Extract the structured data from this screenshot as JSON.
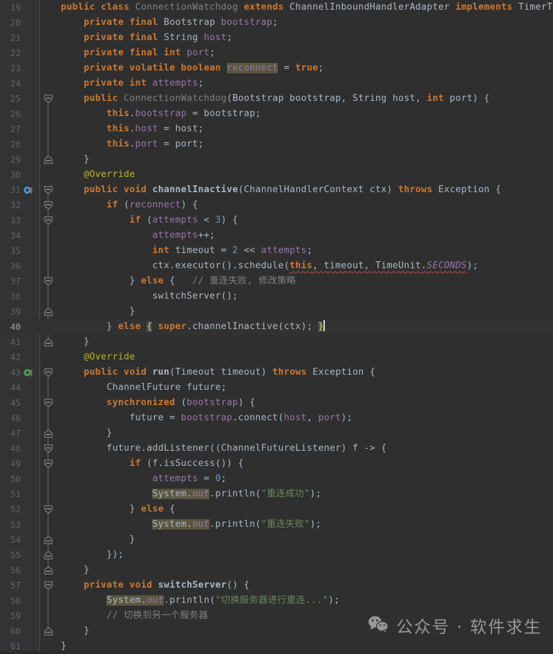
{
  "editor": {
    "language": "Java",
    "theme": "Darcula",
    "background": "#2f2f2f",
    "gutter_background": "#313335",
    "current_line": 40,
    "first_line": 19,
    "last_line": 61,
    "colors": {
      "keyword": "#cc7832",
      "string": "#6a8759",
      "number": "#6897bb",
      "comment": "#808080",
      "annotation": "#bbb529",
      "field": "#9876aa",
      "method": "#ffc66d",
      "default_text": "#a9b7c6",
      "line_number": "#606366",
      "identifier_highlight": "#5b5640",
      "brace_match": "#3b514d",
      "error_squiggle": "#9e4444"
    }
  },
  "lines": [
    {
      "n": 19,
      "indent": 0,
      "html": "<span class=\"kw-b\">public</span> <span class=\"kw-b\">class</span> <span class=\"dim\">ConnectionWatchdog</span> <span class=\"kw-b\">extends</span> <span class=\"typ\">ChannelInboundHandlerAdapter</span> <span class=\"kw-b\">implements</span> <span class=\"typ\">TimerTask</span> {"
    },
    {
      "n": 20,
      "indent": 1,
      "html": "    <span class=\"kw-b\">private</span> <span class=\"kw-b\">final</span> <span class=\"typ\">Bootstrap</span> <span class=\"fld\">bootstrap</span>;"
    },
    {
      "n": 21,
      "indent": 1,
      "html": "    <span class=\"kw-b\">private</span> <span class=\"kw-b\">final</span> <span class=\"typ\">String</span> <span class=\"fld\">host</span>;"
    },
    {
      "n": 22,
      "indent": 1,
      "html": "    <span class=\"kw-b\">private</span> <span class=\"kw-b\">final</span> <span class=\"kw-b\">int</span> <span class=\"fld\">port</span>;"
    },
    {
      "n": 23,
      "indent": 1,
      "html": "    <span class=\"kw-b\">private</span> <span class=\"kw-b\">volatile</span> <span class=\"kw-b\">boolean</span> <span class=\"fld idhl\">reconnect</span> = <span class=\"kw-b\">true</span>;"
    },
    {
      "n": 24,
      "indent": 1,
      "html": "    <span class=\"kw-b\">private</span> <span class=\"kw-b\">int</span> <span class=\"fld\">attempts</span>;"
    },
    {
      "n": 25,
      "indent": 1,
      "html": "    <span class=\"kw-b\">public</span> <span class=\"dim\">ConnectionWatchdog</span>(<span class=\"typ\">Bootstrap</span> bootstrap, <span class=\"typ\">String</span> host, <span class=\"kw-b\">int</span> port) {"
    },
    {
      "n": 26,
      "indent": 2,
      "html": "        <span class=\"kw-b\">this</span>.<span class=\"fld\">bootstrap</span> = bootstrap;"
    },
    {
      "n": 27,
      "indent": 2,
      "html": "        <span class=\"kw-b\">this</span>.<span class=\"fld\">host</span> = host;"
    },
    {
      "n": 28,
      "indent": 2,
      "html": "        <span class=\"kw-b\">this</span>.<span class=\"fld\">port</span> = port;"
    },
    {
      "n": 29,
      "indent": 1,
      "html": "    }"
    },
    {
      "n": 30,
      "indent": 1,
      "html": "    <span class=\"ann\">@Override</span>"
    },
    {
      "n": 31,
      "indent": 1,
      "html": "    <span class=\"kw-b\">public</span> <span class=\"kw-b\">void</span> <span class=\"typ\" style=\"font-weight:bold\">channelInactive</span>(<span class=\"typ\">ChannelHandlerContext</span> ctx) <span class=\"kw-b\">throws</span> <span class=\"typ\">Exception</span> {"
    },
    {
      "n": 32,
      "indent": 2,
      "html": "        <span class=\"kw-b\">if</span> (<span class=\"fld\">reconnect</span>) {"
    },
    {
      "n": 33,
      "indent": 3,
      "html": "            <span class=\"kw-b\">if</span> (<span class=\"fld\">attempts</span> &lt; <span class=\"num\">3</span>) {"
    },
    {
      "n": 34,
      "indent": 4,
      "html": "                <span class=\"fld\">attempts</span>++;"
    },
    {
      "n": 35,
      "indent": 4,
      "html": "                <span class=\"kw-b\">int</span> timeout = <span class=\"num\">2</span> &lt;&lt; <span class=\"fld\">attempts</span>;"
    },
    {
      "n": 36,
      "indent": 4,
      "html": "                ctx.executor().schedule(<span class=\"sq\"><span class=\"kw-b\">this</span>, timeout, <span class=\"typ\">TimeUnit</span>.<span class=\"cnst\">SECONDS</span></span>);"
    },
    {
      "n": 37,
      "indent": 3,
      "html": "            } <span class=\"kw-b\">else</span> {   <span class=\"cmt\">// 重连失败, 修改策略</span>"
    },
    {
      "n": 38,
      "indent": 4,
      "html": "                switchServer();"
    },
    {
      "n": 39,
      "indent": 3,
      "html": "            }"
    },
    {
      "n": 40,
      "indent": 2,
      "html": "        } <span class=\"kw-b\">else</span> <span class=\"brace\">{</span> <span class=\"kw-b\">super</span>.channelInactive(ctx); <span class=\"brace\">}</span><span class=\"caret\"></span>"
    },
    {
      "n": 41,
      "indent": 1,
      "html": "    }"
    },
    {
      "n": 42,
      "indent": 1,
      "html": "    <span class=\"ann\">@Override</span>"
    },
    {
      "n": 43,
      "indent": 1,
      "html": "    <span class=\"kw-b\">public</span> <span class=\"kw-b\">void</span> <span class=\"typ\" style=\"font-weight:bold\">run</span>(<span class=\"typ\">Timeout</span> timeout) <span class=\"kw-b\">throws</span> <span class=\"typ\">Exception</span> {"
    },
    {
      "n": 44,
      "indent": 2,
      "html": "        <span class=\"typ\">ChannelFuture</span> future;"
    },
    {
      "n": 45,
      "indent": 2,
      "html": "        <span class=\"kw-b\">synchronized</span> (<span class=\"fld\">bootstrap</span>) {"
    },
    {
      "n": 46,
      "indent": 3,
      "html": "            future = <span class=\"fld\">bootstrap</span>.connect(<span class=\"fld\">host</span>, <span class=\"fld\">port</span>);"
    },
    {
      "n": 47,
      "indent": 2,
      "html": "        }"
    },
    {
      "n": 48,
      "indent": 2,
      "html": "        future.addListener((<span class=\"typ\">ChannelFutureListener</span>) f -&gt; {"
    },
    {
      "n": 49,
      "indent": 3,
      "html": "            <span class=\"kw-b\">if</span> (f.isSuccess()) {"
    },
    {
      "n": 50,
      "indent": 4,
      "html": "                <span class=\"fld\">attempts</span> = <span class=\"num\">0</span>;"
    },
    {
      "n": 51,
      "indent": 4,
      "html": "                <span class=\"idhl\"><span class=\"typ\">System</span>.<span class=\"stc\">out</span></span>.println(<span class=\"str\">\"重连成功\"</span>);"
    },
    {
      "n": 52,
      "indent": 3,
      "html": "            } <span class=\"kw-b\">else</span> {"
    },
    {
      "n": 53,
      "indent": 4,
      "html": "                <span class=\"idhl\"><span class=\"typ\">System</span>.<span class=\"stc\">out</span></span>.println(<span class=\"str\">\"重连失败\"</span>);"
    },
    {
      "n": 54,
      "indent": 3,
      "html": "            }"
    },
    {
      "n": 55,
      "indent": 2,
      "html": "        });"
    },
    {
      "n": 56,
      "indent": 1,
      "html": "    }"
    },
    {
      "n": 57,
      "indent": 1,
      "html": "    <span class=\"kw-b\">private</span> <span class=\"kw-b\">void</span> <span class=\"typ\" style=\"font-weight:bold\">switchServer</span>() {"
    },
    {
      "n": 58,
      "indent": 2,
      "html": "        <span class=\"idhl\"><span class=\"typ\">System</span>.<span class=\"stc\">out</span></span>.println(<span class=\"str\">\"切换服务器进行重连...\"</span>);"
    },
    {
      "n": 59,
      "indent": 2,
      "html": "        <span class=\"cmt\">// 切换到另一个服务器</span>"
    },
    {
      "n": 60,
      "indent": 1,
      "html": "    }"
    },
    {
      "n": 61,
      "indent": 0,
      "html": "}"
    }
  ],
  "gutter_markers": [
    {
      "line": 31,
      "type": "overriding-method-marker",
      "color": "#4e94ce",
      "arrow_color": "#b85b34",
      "tooltip": "Overrides method in ChannelInboundHandlerAdapter"
    },
    {
      "line": 43,
      "type": "implementing-method-marker",
      "color": "#499c54",
      "arrow_color": "#b85b34",
      "tooltip": "Implements method in TimerTask"
    }
  ],
  "fold_regions": [
    {
      "start": 25,
      "end": 29
    },
    {
      "start": 31,
      "end": 41
    },
    {
      "start": 32,
      "end": 40
    },
    {
      "start": 33,
      "end": 37
    },
    {
      "start": 37,
      "end": 39
    },
    {
      "start": 43,
      "end": 56
    },
    {
      "start": 45,
      "end": 47
    },
    {
      "start": 48,
      "end": 55
    },
    {
      "start": 49,
      "end": 52
    },
    {
      "start": 52,
      "end": 54
    },
    {
      "start": 57,
      "end": 60
    }
  ],
  "watermark": {
    "icon": "wechat-logo-icon",
    "text": "公众号 · 软件求生"
  }
}
